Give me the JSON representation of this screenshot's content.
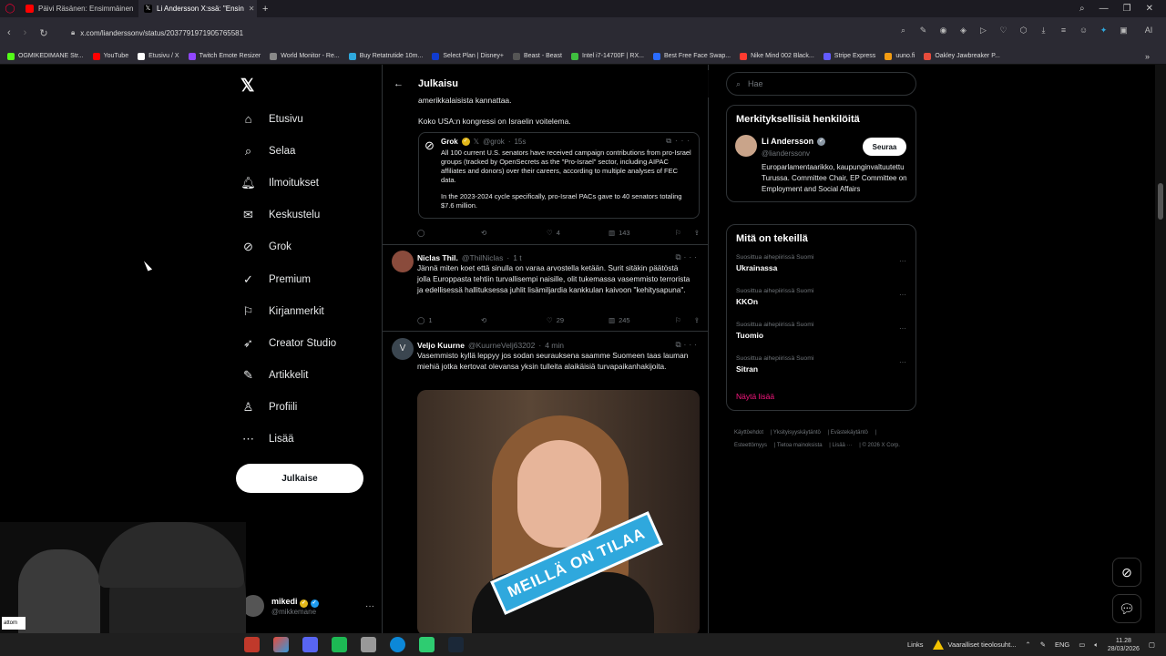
{
  "browser": {
    "tabs": [
      {
        "label": "Päivi Räsänen: Ensimmäinen",
        "icon": "youtube-icon",
        "active": false
      },
      {
        "label": "Li Andersson X:ssä: \"Ensin",
        "icon": "x-icon",
        "active": true
      }
    ],
    "url": "x.com/lianderssonv/status/2037791971905765581",
    "bookmarks": [
      {
        "label": "OGMIKEDIMANE Str...",
        "color": "#53fc18"
      },
      {
        "label": "YouTube",
        "color": "#ff0000"
      },
      {
        "label": "Etusivu / X",
        "color": "#ffffff"
      },
      {
        "label": "Twitch Emote Resizer",
        "color": "#9146ff"
      },
      {
        "label": "World Monitor - Re...",
        "color": "#888888"
      },
      {
        "label": "Buy Retatrutide 10m...",
        "color": "#2fa8dd"
      },
      {
        "label": "Select Plan | Disney+",
        "color": "#113ccf"
      },
      {
        "label": "Beast - Beast",
        "color": "#555555"
      },
      {
        "label": "Intel i7-14700F | RX...",
        "color": "#3fbf3f"
      },
      {
        "label": "Best Free Face Swap...",
        "color": "#2b6cff"
      },
      {
        "label": "Nike Mind 002 Black...",
        "color": "#ff3b30"
      },
      {
        "label": "Stripe Express",
        "color": "#635bff"
      },
      {
        "label": "uuno.fi",
        "color": "#f39c12"
      },
      {
        "label": "Oakley Jawbreaker P...",
        "color": "#e74c3c"
      }
    ]
  },
  "nav": {
    "items": [
      {
        "label": "Etusivu",
        "icon": "home-icon",
        "glyph": "⌂"
      },
      {
        "label": "Selaa",
        "icon": "search-icon",
        "glyph": "⌕"
      },
      {
        "label": "Ilmoitukset",
        "icon": "bell-icon",
        "glyph": "🔔︎"
      },
      {
        "label": "Keskustelu",
        "icon": "envelope-icon",
        "glyph": "✉"
      },
      {
        "label": "Grok",
        "icon": "grok-icon",
        "glyph": "⊘"
      },
      {
        "label": "Premium",
        "icon": "premium-icon",
        "glyph": "✓"
      },
      {
        "label": "Kirjanmerkit",
        "icon": "bookmark-icon",
        "glyph": "⚐"
      },
      {
        "label": "Creator Studio",
        "icon": "rocket-icon",
        "glyph": "➶"
      },
      {
        "label": "Artikkelit",
        "icon": "article-icon",
        "glyph": "✎"
      },
      {
        "label": "Profiili",
        "icon": "profile-icon",
        "glyph": "♙"
      },
      {
        "label": "Lisää",
        "icon": "more-circle-icon",
        "glyph": "⋯"
      }
    ],
    "post_label": "Julkaise",
    "account": {
      "name": "mikedi",
      "handle": "@mikkemane"
    }
  },
  "center": {
    "title": "Julkaisu",
    "prev_line1": "amerikkalaisista kannattaa.",
    "prev_line2": "Koko USA:n kongressi on Israelin voitelema.",
    "quote": {
      "name": "Grok",
      "handle": "@grok",
      "time": "15s",
      "p1": "All 100 current U.S. senators have received campaign contributions from pro-Israel groups (tracked by OpenSecrets as the \"Pro-Israel\" sector, including AIPAC affiliates and donors) over their careers, according to multiple analyses of FEC data.",
      "p2": "In the 2023-2024 cycle specifically, pro-Israel PACs gave to 40 senators totaling $7.6 million."
    },
    "actions1": {
      "replies": "",
      "reposts": "",
      "likes": "4",
      "views": "143"
    },
    "tweet2": {
      "name": "Niclas Thil.",
      "handle": "@ThilNiclas",
      "time": "1 t",
      "text": "Jännä miten koet että sinulla on varaa arvostella ketään. Surit sitäkin päätöstä jolla Europpasta tehtiin turvallisempi naisille, olit tukemassa vasemmisto terrorista ja edellisessä hallituksessa juhlit lisämiljardia kankkulan kaivoon \"kehitysapuna\"."
    },
    "actions2": {
      "replies": "1",
      "reposts": "",
      "likes": "29",
      "views": "245"
    },
    "tweet3": {
      "name": "Veljo Kuurne",
      "handle": "@KuurneVelj63202",
      "time": "4 min",
      "avatar_letter": "V",
      "text": "Vasemmisto kyllä leppyy jos sodan seurauksena saamme Suomeen taas lauman miehiä jotka kertovat olevansa yksin tulleita alaikäisiä turvapaikanhakijoita.",
      "image_sign": "MEILLÄ ON TILAA"
    }
  },
  "right": {
    "search_placeholder": "Hae",
    "who_title": "Merkityksellisiä henkilöitä",
    "person": {
      "name": "Li Andersson",
      "handle": "@lianderssonv",
      "follow_label": "Seuraa",
      "bio": "Europarlamentaarikko, kaupunginvaltuutettu Turussa. Committee Chair, EP Committee on Employment and Social Affairs"
    },
    "trends_title": "Mitä on tekeillä",
    "trends": [
      {
        "context": "Suosittua aihepiirissä Suomi",
        "title": "Ukrainassa"
      },
      {
        "context": "Suosittua aihepiirissä Suomi",
        "title": "KKOn"
      },
      {
        "context": "Suosittua aihepiirissä Suomi",
        "title": "Tuomio"
      },
      {
        "context": "Suosittua aihepiirissä Suomi",
        "title": "Sitran"
      }
    ],
    "show_more": "Näytä lisää",
    "footer": [
      "Käyttöehdot",
      "Yksityisyyskäytäntö",
      "Evästekäytäntö",
      "Esteettömyys",
      "Tietoa mainoksista",
      "Lisää ···",
      "© 2026 X Corp."
    ]
  },
  "taskbar": {
    "links_label": "Links",
    "warning": "Vaaralliset tieolosuht...",
    "lang": "ENG",
    "time": "11.28",
    "date": "28/03/2026"
  },
  "webcam_tooltip": "attom"
}
